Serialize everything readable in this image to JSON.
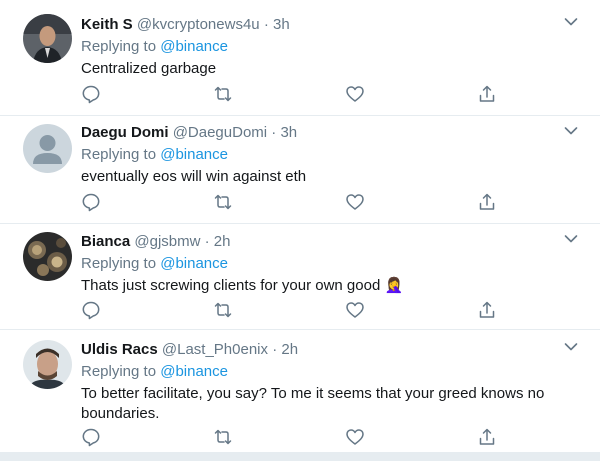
{
  "tweets": [
    {
      "name": "Keith S",
      "handle": "@kvcryptonews4u",
      "dot": "·",
      "time": "3h",
      "replying_prefix": "Replying to",
      "replying_handle": "@binance",
      "text": "Centralized garbage"
    },
    {
      "name": "Daegu Domi",
      "handle": "@DaeguDomi",
      "dot": "·",
      "time": "3h",
      "replying_prefix": "Replying to",
      "replying_handle": "@binance",
      "text": "eventually eos will win against eth"
    },
    {
      "name": "Bianca",
      "handle": "@gjsbmw",
      "dot": "·",
      "time": "2h",
      "replying_prefix": "Replying to",
      "replying_handle": "@binance",
      "text": "Thats just screwing clients for your own good 🤦‍♀️"
    },
    {
      "name": "Uldis Racs",
      "handle": "@Last_Ph0enix",
      "dot": "·",
      "time": "2h",
      "replying_prefix": "Replying to",
      "replying_handle": "@binance",
      "text": "To better facilitate, you say? To me it seems that your greed knows no boundaries."
    }
  ],
  "icons": {
    "reply": "reply-icon",
    "retweet": "retweet-icon",
    "like": "like-icon",
    "share": "share-icon",
    "more": "chevron-down-icon"
  },
  "colors": {
    "link": "#1b95e0",
    "secondary_text": "#657786",
    "divider": "#e6ecf0"
  }
}
